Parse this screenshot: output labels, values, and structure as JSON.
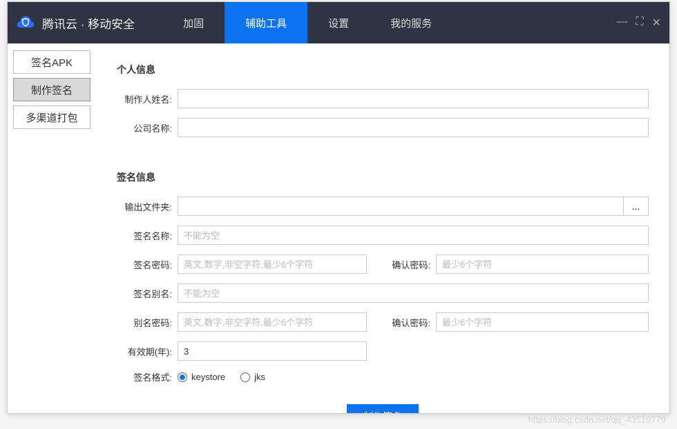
{
  "app": {
    "title": "腾讯云 · 移动安全"
  },
  "topnav": {
    "items": [
      {
        "label": "加固"
      },
      {
        "label": "辅助工具"
      },
      {
        "label": "设置"
      },
      {
        "label": "我的服务"
      }
    ],
    "activeIndex": 1
  },
  "sidebar": {
    "items": [
      {
        "label": "签名APK"
      },
      {
        "label": "制作签名"
      },
      {
        "label": "多渠道打包"
      }
    ],
    "activeIndex": 1
  },
  "sections": {
    "personal": {
      "title": "个人信息"
    },
    "signature": {
      "title": "签名信息"
    }
  },
  "form": {
    "author_label": "制作人姓名:",
    "author_value": "",
    "company_label": "公司名称:",
    "company_value": "",
    "outdir_label": "输出文件夹:",
    "outdir_value": "",
    "browse_label": "...",
    "signname_label": "签名名称:",
    "signname_placeholder": "不能为空",
    "signpwd_label": "签名密码:",
    "signpwd_placeholder": "英文,数字,非空字符,最少6个字符",
    "confirmpwd_label": "确认密码:",
    "confirmpwd_placeholder": "最少6个字符",
    "alias_label": "签名别名:",
    "alias_placeholder": "不能为空",
    "aliaspwd_label": "别名密码:",
    "aliaspwd_placeholder": "英文,数字,非空字符,最少6个字符",
    "aliasconfirm_label": "确认密码:",
    "aliasconfirm_placeholder": "最少6个字符",
    "validity_label": "有效期(年):",
    "validity_value": "3",
    "format_label": "签名格式:",
    "format_options": [
      {
        "label": "keystore",
        "checked": true
      },
      {
        "label": "jks",
        "checked": false
      }
    ],
    "submit_label": "制作签名"
  },
  "watermark": "https://blog.csdn.net/qq_43519779"
}
